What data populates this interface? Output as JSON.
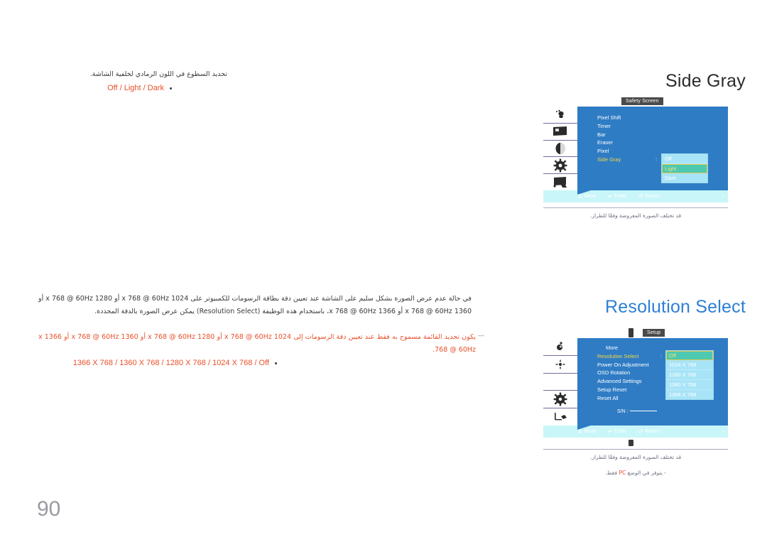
{
  "page": {
    "number": "90"
  },
  "sections": [
    {
      "id": "side-gray",
      "title": "Side Gray",
      "description_ar": "تحديد السطوع في اللون الرمادي لخلفية الشاشة.",
      "values_label": "Off / Light / Dark",
      "osd": {
        "tab_label": "Safety Screen",
        "menu_items": [
          {
            "label": "Pixel Shift",
            "selected": false
          },
          {
            "label": "Timer",
            "selected": false
          },
          {
            "label": "Bar",
            "selected": false
          },
          {
            "label": "Eraser",
            "selected": false
          },
          {
            "label": "Pixel",
            "selected": false
          },
          {
            "label": "Side Gray",
            "selected": true
          }
        ],
        "colon": ":",
        "options": [
          {
            "label": "Off",
            "active": false
          },
          {
            "label": "Light",
            "active": true
          },
          {
            "label": "Dark",
            "active": false
          }
        ],
        "footer": [
          {
            "glyph": "⇅",
            "label": "Move",
            "icon": "updown-arrow-icon"
          },
          {
            "glyph": "↵",
            "label": "Enter",
            "icon": "enter-key-icon"
          },
          {
            "glyph": "↺",
            "label": "Return",
            "icon": "return-arrow-icon"
          }
        ],
        "footer_dash": "–"
      },
      "caption_ar": "قد تختلف الصورة المعروضة وفقًا للطراز."
    },
    {
      "id": "resolution-select",
      "title": "Resolution Select",
      "paragraph_ar": "في حالة عدم عرض الصورة بشكل سليم على الشاشة عند تعيين دقة بطاقة الرسومات للكمبيوتر على 1024 x 768 @ 60Hz أو 1280 x 768 @ 60Hz أو 1360 x 768 @ 60Hz أو 1366 x 768 @ 60Hz، باستخدام هذه الوظيفة (Resolution Select) يمكن عرض الصورة بالدقة المحددة.",
      "note_marker": "―",
      "note_ar": "يكون تحديد القائمة مسموح به فقط عند تعيين دقة الرسومات إلى 1024 x 768 @ 60Hz أو 1280 x 768 @ 60Hz أو 1360 x 768 @ 60Hz أو 1366 x 768 @ 60Hz.",
      "values_label": "1366 X 768 / 1360 X 768 / 1280 X 768 / 1024 X 768 / Off",
      "osd": {
        "tab_label": "Setup",
        "menu_items": [
          {
            "label": "More",
            "selected": false,
            "indent": true
          },
          {
            "label": "Resolution Select",
            "selected": true
          },
          {
            "label": "Power On Adjustment",
            "selected": false
          },
          {
            "label": "OSD Rotation",
            "selected": false
          },
          {
            "label": "Advanced Settings",
            "selected": false
          },
          {
            "label": "Setup Reset",
            "selected": false
          },
          {
            "label": "Reset All",
            "selected": false
          }
        ],
        "colon": ":",
        "sn_label": "S/N :",
        "options": [
          {
            "label": "Off",
            "active": true
          },
          {
            "label": "1024 X 768",
            "active": false
          },
          {
            "label": "1280 X 768",
            "active": false
          },
          {
            "label": "1360 X 768",
            "active": false
          },
          {
            "label": "1366 X 768",
            "active": false
          }
        ],
        "footer": [
          {
            "glyph": "⇅",
            "label": "Move",
            "icon": "updown-arrow-icon"
          },
          {
            "glyph": "↵",
            "label": "Enter",
            "icon": "enter-key-icon"
          },
          {
            "glyph": "↺",
            "label": "Return",
            "icon": "return-arrow-icon"
          }
        ],
        "footer_dash": "–"
      },
      "caption_ar": "قد تختلف الصورة المعروضة وفقًا للطراز.",
      "caption_note_ar_prefix": "- يتوفر في الوضع ",
      "caption_note_ar_pc": "PC",
      "caption_note_ar_suffix": " فقط."
    }
  ],
  "colors": {
    "osd_panel_blue": "#2e7cc4",
    "osd_footer_cyan": "#c9f6f8",
    "dropdown_bg": "#a8e4f7",
    "dropdown_active": "#4cc9b0",
    "dropdown_active_border": "#e3c84a",
    "selected_item_yellow": "#f5d742",
    "accent_orange": "#e8502a",
    "title_blue": "#2e7fd4",
    "page_number_gray": "#9a9aa3"
  }
}
